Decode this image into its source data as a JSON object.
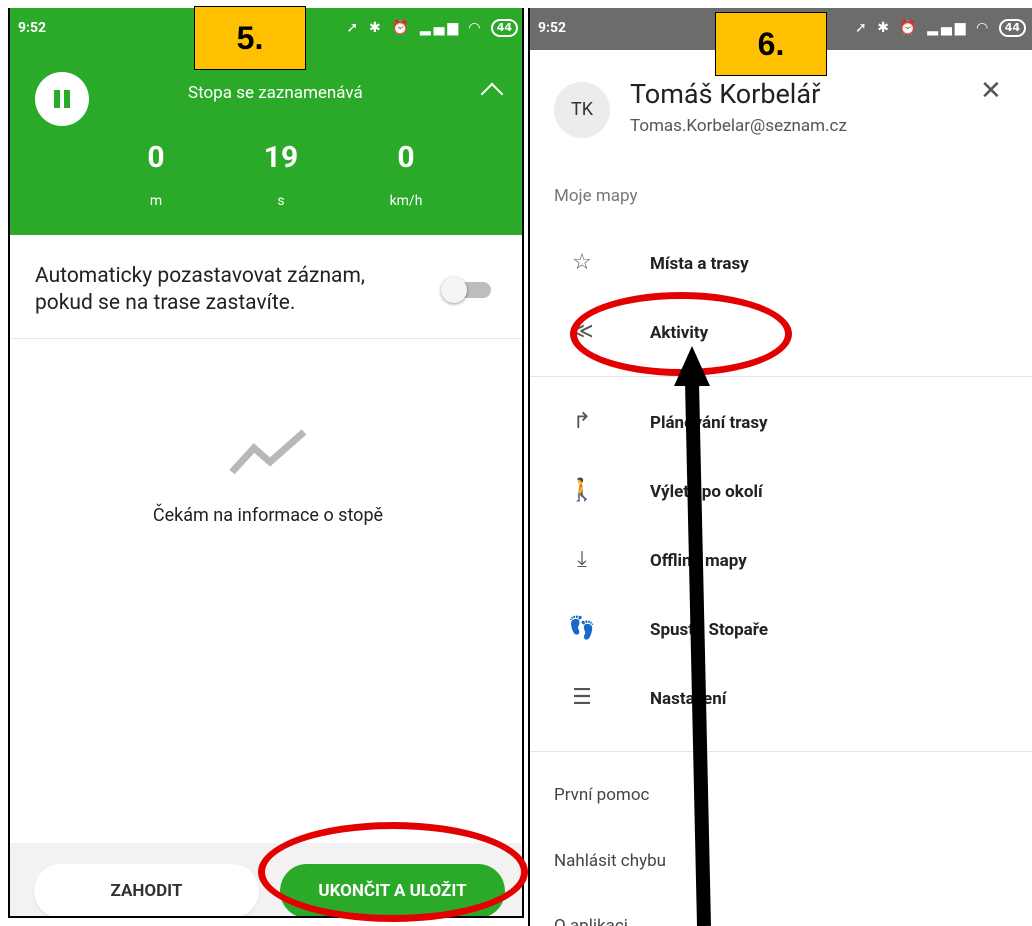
{
  "left_screen": {
    "status": {
      "time": "9:52",
      "battery": "44"
    },
    "step_label": "5.",
    "track_status": "Stopa se zaznamenává",
    "stats": [
      {
        "value": "0",
        "unit": "m"
      },
      {
        "value": "19",
        "unit": "s"
      },
      {
        "value": "0",
        "unit": "km/h"
      }
    ],
    "auto_pause_text": "Automaticky pozastavovat záznam, pokud se na trase zastavíte.",
    "waiting_text": "Čekám na informace o stopě",
    "discard_label": "ZAHODIT",
    "save_label": "UKONČIT A ULOŽIT"
  },
  "right_screen": {
    "status": {
      "time": "9:52",
      "battery": "44"
    },
    "step_label": "6.",
    "user": {
      "initials": "TK",
      "name": "Tomáš Korbelář",
      "email": "Tomas.Korbelar@seznam.cz"
    },
    "section_label": "Moje mapy",
    "menu_group1": [
      {
        "icon": "☆",
        "label": "Místa a trasy"
      },
      {
        "icon": "≪",
        "label": "Aktivity"
      }
    ],
    "menu_group2": [
      {
        "icon": "↱",
        "label": "Plánování trasy"
      },
      {
        "icon": "🚶",
        "label": "Výlety po okolí"
      },
      {
        "icon": "⤓",
        "label": "Offline mapy"
      },
      {
        "icon": "👣",
        "label": "Spustit Stopaře"
      },
      {
        "icon": "☰",
        "label": "Nastavení"
      }
    ],
    "extra_items": [
      "První pomoc",
      "Nahlásit chybu",
      "O aplikaci"
    ]
  }
}
